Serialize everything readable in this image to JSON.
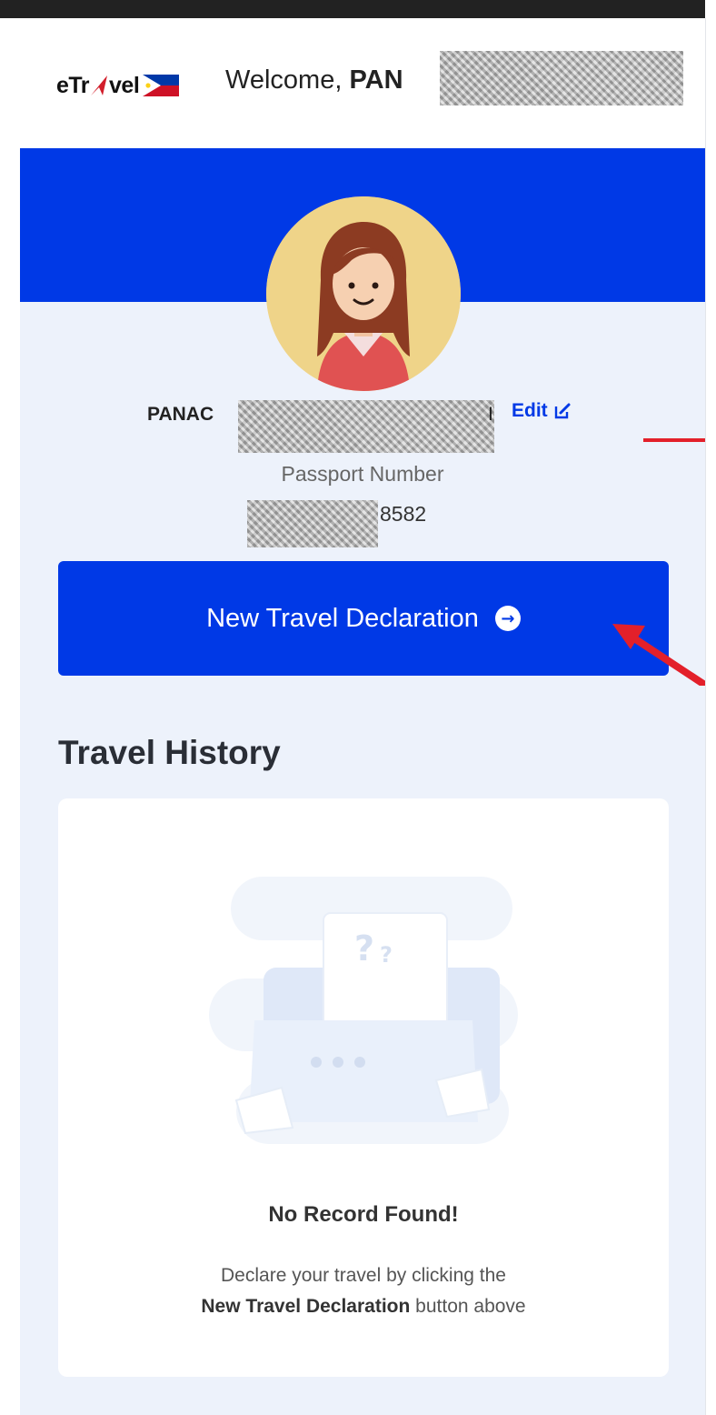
{
  "header": {
    "logo_text_1": "eTr",
    "logo_text_2": "vel",
    "welcome_label": "Welcome,",
    "welcome_name_visible": "PAN"
  },
  "profile": {
    "name_visible_prefix": "PANAC",
    "name_visible_suffix": "I",
    "edit_label": "Edit",
    "passport_label": "Passport Number",
    "passport_visible_suffix": "8582"
  },
  "actions": {
    "new_declaration_label": "New Travel Declaration"
  },
  "history": {
    "title": "Travel History",
    "empty_title": "No Record Found!",
    "empty_line1": "Declare your travel by clicking the",
    "empty_line2_bold": "New Travel Declaration",
    "empty_line2_rest": "button above"
  },
  "colors": {
    "brand_blue": "#0039e6",
    "annotation_red": "#e3202a",
    "background": "#edf2fb"
  },
  "icons": {
    "flag": "philippine-flag-icon",
    "edit": "edit-icon",
    "cta": "arrow-right-circle-icon"
  }
}
